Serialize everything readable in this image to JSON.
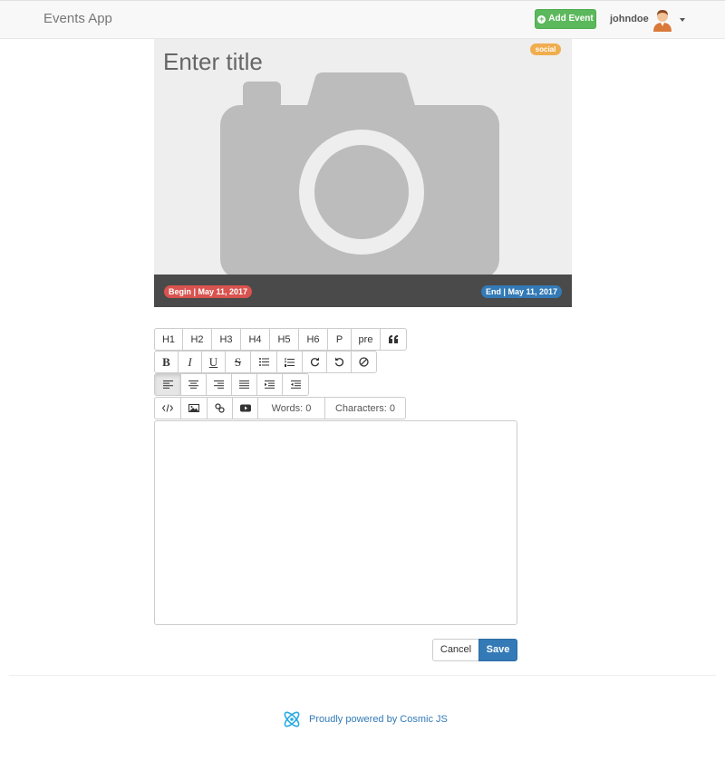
{
  "navbar": {
    "brand": "Events App",
    "add_event_label": "Add Event",
    "username": "johndoe"
  },
  "cover": {
    "title_placeholder": "Enter title",
    "category_badge": "social",
    "begin_label": "Begin | May 11, 2017",
    "end_label": "End | May 11, 2017"
  },
  "toolbar": {
    "heading_buttons": [
      "H1",
      "H2",
      "H3",
      "H4",
      "H5",
      "H6",
      "P",
      "pre"
    ],
    "format_buttons": {
      "bold": "B",
      "italic": "I",
      "underline": "U",
      "strikethrough": "S"
    },
    "words_label": "Words: 0",
    "characters_label": "Characters: 0"
  },
  "actions": {
    "cancel_label": "Cancel",
    "save_label": "Save"
  },
  "footer": {
    "text": "Proudly powered by Cosmic JS"
  },
  "colors": {
    "success": "#5cb85c",
    "primary": "#337ab7",
    "danger": "#d9534f",
    "warning": "#f0ad4e"
  }
}
